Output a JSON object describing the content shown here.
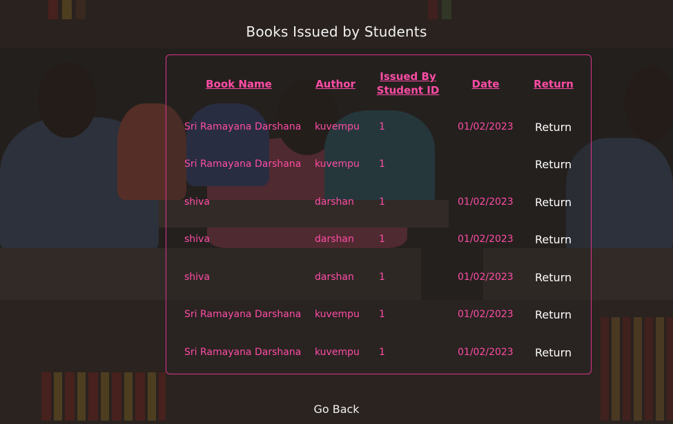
{
  "page": {
    "title": "Books Issued by Students",
    "go_back_label": "Go Back"
  },
  "table": {
    "headers": {
      "book_name": "Book Name",
      "author": "Author",
      "issued_by_line1": "Issued By",
      "issued_by_line2": "Student ID",
      "date": "Date",
      "return": "Return"
    },
    "rows": [
      {
        "book": "Sri Ramayana Darshana",
        "author": "kuvempu",
        "student_id": "1",
        "date": "01/02/2023",
        "action": "Return"
      },
      {
        "book": "Sri Ramayana Darshana",
        "author": "kuvempu",
        "student_id": "1",
        "date": "",
        "action": "Return"
      },
      {
        "book": "shiva",
        "author": "darshan",
        "student_id": "1",
        "date": "01/02/2023",
        "action": "Return"
      },
      {
        "book": "shiva",
        "author": "darshan",
        "student_id": "1",
        "date": "01/02/2023",
        "action": "Return"
      },
      {
        "book": "shiva",
        "author": "darshan",
        "student_id": "1",
        "date": "01/02/2023",
        "action": "Return"
      },
      {
        "book": "Sri Ramayana Darshana",
        "author": "kuvempu",
        "student_id": "1",
        "date": "01/02/2023",
        "action": "Return"
      },
      {
        "book": "Sri Ramayana Darshana",
        "author": "kuvempu",
        "student_id": "1",
        "date": "01/02/2023",
        "action": "Return"
      }
    ]
  },
  "colors": {
    "accent": "#ff4da6",
    "border": "#e0338f",
    "text_light": "#f2f2f2"
  }
}
